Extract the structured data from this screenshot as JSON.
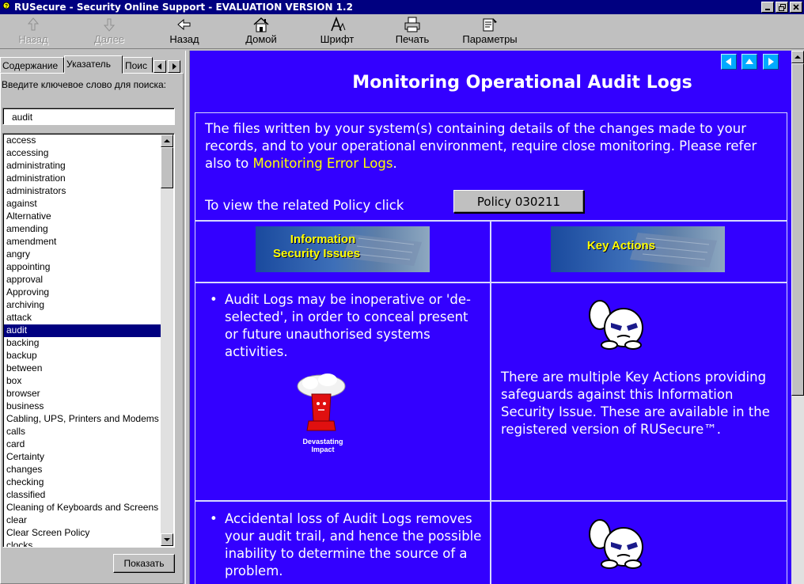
{
  "window": {
    "title": "RUSecure - Security Online Support - EVALUATION VERSION 1.2"
  },
  "toolbar": {
    "back_disabled": "Назад",
    "forward_disabled": "Далее",
    "back": "Назад",
    "home": "Домой",
    "font": "Шрифт",
    "print": "Печать",
    "options": "Параметры"
  },
  "sidebar": {
    "tabs": [
      "Содержание",
      "Указатель",
      "Поис"
    ],
    "prompt": "Введите ключевое слово для поиска:",
    "keyword": "audit",
    "show_button": "Показать",
    "items": [
      "access",
      "accessing",
      "administrating",
      "administration",
      "administrators",
      "against",
      "Alternative",
      "amending",
      "amendment",
      "angry",
      "appointing",
      "approval",
      "Approving",
      "archiving",
      "attack",
      "audit",
      "backing",
      "backup",
      "between",
      "box",
      "browser",
      "business",
      "Cabling, UPS, Printers and Modems",
      "calls",
      "card",
      "Certainty",
      "changes",
      "checking",
      "classified",
      "Cleaning of Keyboards and Screens",
      "clear",
      "Clear Screen Policy",
      "clocks"
    ],
    "selected": "audit"
  },
  "content": {
    "heading": "Monitoring Operational Audit Logs",
    "intro_text": "The files written by your system(s) containing details of the changes made to your records, and to your operational environment, require close monitoring. Please refer also to ",
    "intro_link": "Monitoring Error Logs",
    "intro_end": ".",
    "policy_prompt": "To view the related Policy click",
    "policy_button": "Policy 030211",
    "banner_left": "Information Security Issues",
    "banner_left_line1": "Information",
    "banner_left_line2": "Security Issues",
    "banner_right": "Key Actions",
    "issue1": "Audit Logs may be inoperative or 'de-selected', in order to conceal present or future unauthorised systems activities.",
    "impact_line1": "Devastating",
    "impact_line2": "Impact",
    "key_actions_text": "There are multiple Key Actions providing safeguards against this Information Security Issue. These are available in the registered version of RUSecure™.",
    "issue2": "Accidental loss of Audit Logs removes your audit trail, and hence the possible inability to determine the source of a problem."
  }
}
